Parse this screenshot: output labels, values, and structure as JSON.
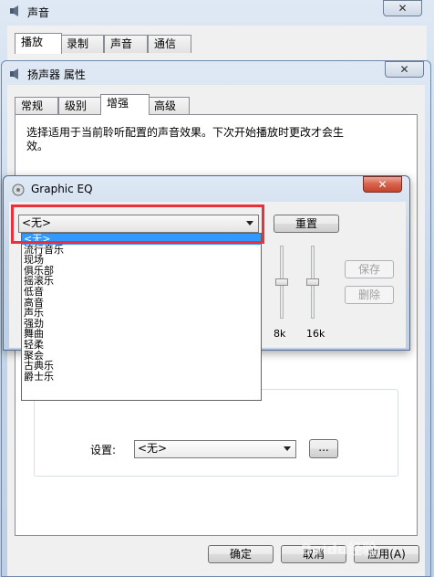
{
  "sound_window": {
    "title": "声音",
    "tabs": [
      "播放",
      "录制",
      "声音",
      "通信"
    ]
  },
  "properties_window": {
    "title": "扬声器 属性",
    "tabs": [
      "常规",
      "级别",
      "增强",
      "高级"
    ],
    "description": "选择适用于当前聆听配置的声音效果。下次开始播放时更改才会生效。",
    "setting_label": "设置:",
    "setting_value": "<无>",
    "browse_label": "...",
    "ok_label": "确定",
    "cancel_label": "取消",
    "apply_label": "应用(A)"
  },
  "eq_window": {
    "title": "Graphic EQ",
    "preset_value": "<无>",
    "reset_label": "重置",
    "save_label": "保存",
    "delete_label": "删除",
    "band_labels": [
      "8k",
      "16k"
    ],
    "preset_options": [
      "<无>",
      "流行音乐",
      "现场",
      "俱乐部",
      "摇滚乐",
      "低音",
      "高音",
      "声乐",
      "强劲",
      "舞曲",
      "轻柔",
      "聚会",
      "古典乐",
      "爵士乐"
    ],
    "selected_index": 0
  },
  "watermark": "Baidu经验",
  "colors": {
    "highlight_box": "#e8313b",
    "selection": "#3399ff",
    "close_red": "#c5432c"
  }
}
